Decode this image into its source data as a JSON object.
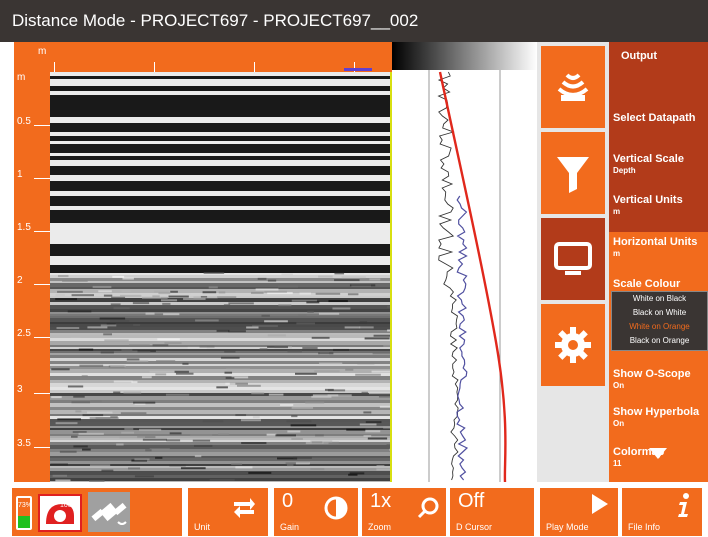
{
  "window": {
    "title": "Distance Mode - PROJECT697 - PROJECT697__002"
  },
  "ruler_top": {
    "unit": "m"
  },
  "ruler_left": {
    "unit": "m",
    "labels": [
      "0.5",
      "1",
      "1.5",
      "2",
      "2.5",
      "3",
      "3.5"
    ]
  },
  "icons": {
    "output": "radar-waves-icon",
    "filter": "funnel-filter-icon",
    "display": "monitor-icon",
    "settings": "gear-icon"
  },
  "menu": {
    "output": "Output",
    "select_datapath": "Select Datapath",
    "vertical_scale": {
      "label": "Vertical Scale",
      "value": "Depth"
    },
    "vertical_units": {
      "label": "Vertical Units",
      "value": "m"
    },
    "horizontal_units": {
      "label": "Horizontal Units",
      "value": "m"
    },
    "scale_colour": {
      "label": "Scale Colour"
    },
    "show_oscope": {
      "label": "Show O-Scope",
      "value": "On"
    },
    "show_hyperbola": {
      "label": "Show Hyperbola",
      "value": "On"
    },
    "colormap": {
      "label": "Colormap",
      "value": "11"
    }
  },
  "scale_colour_options": [
    "White on Black",
    "Black on White",
    "White on Orange",
    "Black on Orange"
  ],
  "bottom": {
    "battery": "73%",
    "unit_level": "100%",
    "unit_label": "Unit",
    "gain_value": "0",
    "gain_label": "Gain",
    "zoom_value": "1x",
    "zoom_label": "Zoom",
    "cursor_value": "Off",
    "cursor_label": "D Cursor",
    "play_label": "Play Mode",
    "info_label": "File Info"
  },
  "colors": {
    "accent": "#f26b1d",
    "dark": "#3a3533",
    "hyperbola": "#e0281c",
    "scope": "#5050a0"
  }
}
